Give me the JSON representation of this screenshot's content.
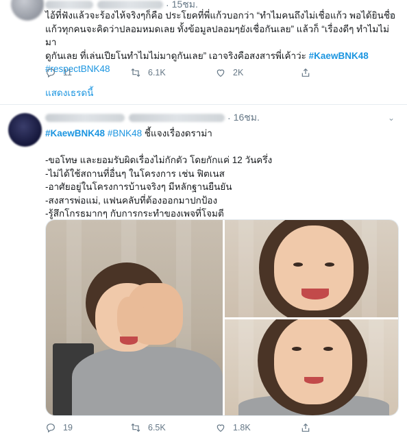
{
  "tweet1": {
    "time": "15ชม.",
    "text_lines": [
      "ไอ้ที่ฟังแล้วจะร้องไห้จริงๆก็คือ ประโยคที่พี่แก้วบอกว่า “ทำไมคนถึงไม่เชื่อแก้ว พอได้ยินชื่อ",
      "แก้วทุกคนจะคิดว่าปลอมหมดเลย ทั้งข้อมูลปลอมๆยังเชื่อกันเลย” แล้วก็ “เรื่องดีๆ ทำไมไม่มา",
      "ดูกันเลย ที่เล่นเปียโนทำไมไม่มาดูกันเลย” เอาจริงคือสงสารพี่เค้าว่ะ "
    ],
    "hashtag_bold": "#KaewBNK48",
    "hashtag2": "#respectBNK48",
    "replies": "11",
    "retweets": "6.1K",
    "likes": "2K",
    "show_thread": "แสดงเธรดนี้"
  },
  "tweet2": {
    "time": "16ชม.",
    "hashtag_bold": "#KaewBNK48",
    "hashtag2": "#BNK48",
    "headline_rest": " ชี้แจงเรื่องดราม่า",
    "points": [
      "-ขอโทษ และยอมรับผิดเรื่องไม่กักตัว โดยกักแค่ 12 วันครึ่ง",
      "-ไม่ได้ใช้สถานที่อื่นๆ ในโครงการ เช่น ฟิตเนส",
      "-อาศัยอยู่ในโครงการบ้านจริงๆ มีหลักฐานยืนยัน",
      "-สงสารพ่อแม่, แฟนคลับที่ต้องออกมาปกป้อง",
      "-รู้สึกโกรธมากๆ กับการกระทำของเพจที่โจมตี"
    ],
    "replies": "19",
    "retweets": "6.5K",
    "likes": "1.8K"
  },
  "icons": [
    "reply-icon",
    "retweet-icon",
    "like-icon",
    "share-icon",
    "chevron-down-icon"
  ],
  "colors": {
    "link": "#1b95e0",
    "muted": "#657786",
    "divider": "#e6ecf0"
  }
}
